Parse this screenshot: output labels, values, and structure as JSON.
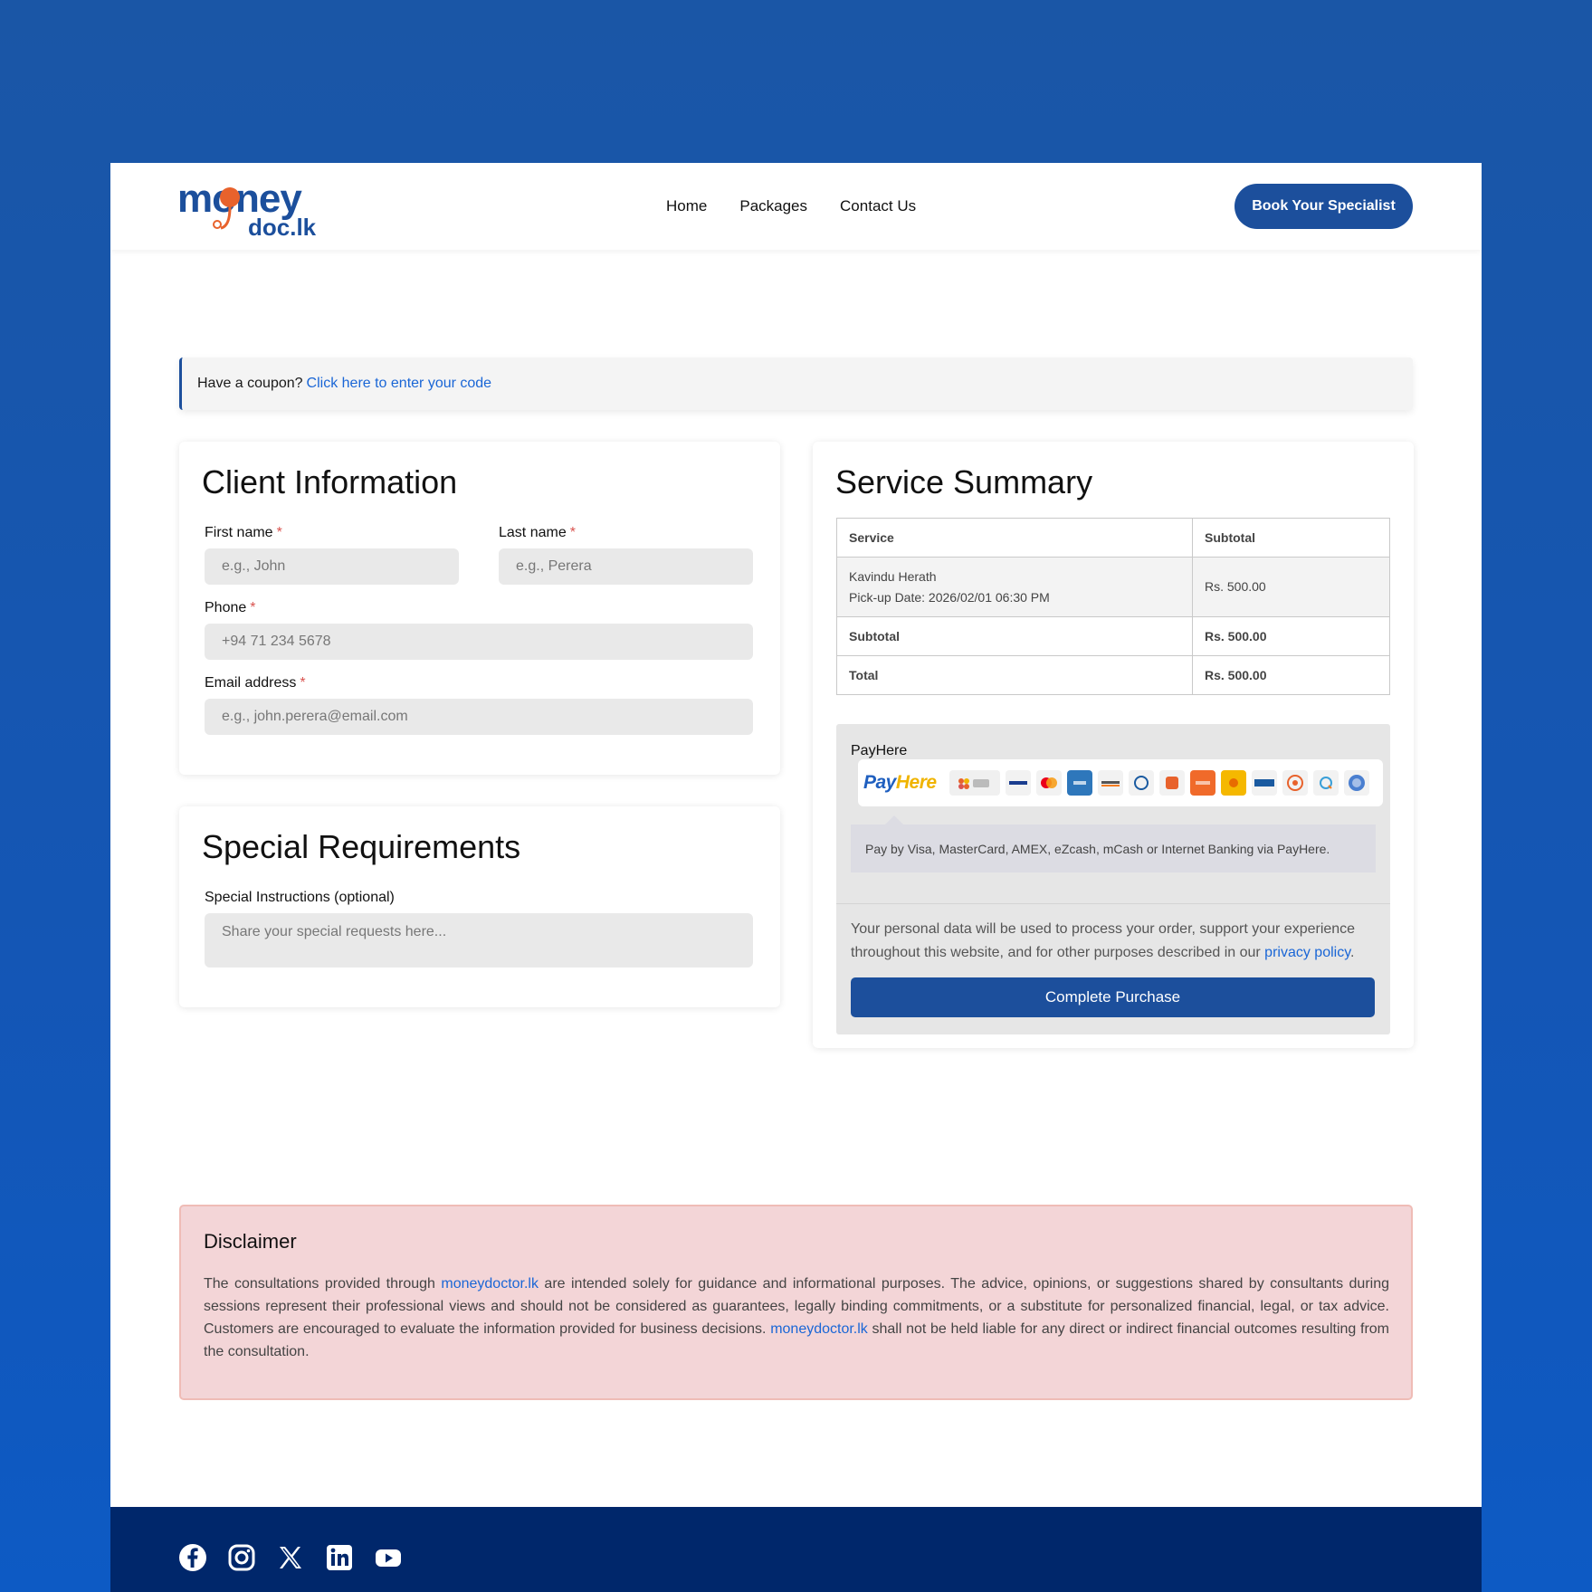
{
  "header": {
    "logo": {
      "word_top": "money",
      "word_bottom": "doc.lk"
    },
    "nav": [
      "Home",
      "Packages",
      "Contact Us"
    ],
    "cta_label": "Book Your Specialist"
  },
  "coupon": {
    "prefix": "Have a coupon?",
    "link": "Click here to enter your code"
  },
  "client": {
    "title": "Client Information",
    "first_name": {
      "label": "First name",
      "placeholder": "e.g., John"
    },
    "last_name": {
      "label": "Last name",
      "placeholder": "e.g., Perera"
    },
    "phone": {
      "label": "Phone",
      "placeholder": "+94 71 234 5678"
    },
    "email": {
      "label": "Email address",
      "placeholder": "e.g., john.perera@email.com"
    },
    "required_mark": "*"
  },
  "special": {
    "title": "Special Requirements",
    "label": "Special Instructions (optional)",
    "placeholder": "Share your special requests here..."
  },
  "summary": {
    "title": "Service Summary",
    "headers": {
      "service": "Service",
      "subtotal": "Subtotal"
    },
    "item": {
      "name": "Kavindu Herath",
      "detail": "Pick-up Date: 2026/02/01 06:30 PM",
      "price": "Rs. 500.00"
    },
    "subtotal": {
      "label": "Subtotal",
      "value": "Rs. 500.00"
    },
    "total": {
      "label": "Total",
      "value": "Rs. 500.00"
    }
  },
  "payment": {
    "method": "PayHere",
    "logo_part1": "Pay",
    "logo_part2": "Here",
    "description": "Pay by Visa, MasterCard, AMEX, eZcash, mCash or Internet Banking via PayHere.",
    "privacy_text": "Your personal data will be used to process your order, support your experience throughout this website, and for other purposes described in our ",
    "privacy_link": "privacy policy",
    "privacy_end": ".",
    "button": "Complete Purchase",
    "icons": [
      "apple-pay-icon",
      "visa-icon",
      "mastercard-icon",
      "amex-icon",
      "discover-icon",
      "diners-icon",
      "genie-icon",
      "frimi-icon",
      "ezcash-icon",
      "bank-icon",
      "seal-icon",
      "q-icon",
      "globe-icon"
    ]
  },
  "disclaimer": {
    "title": "Disclaimer",
    "t1": "The consultations provided through ",
    "link1": "moneydoctor.lk",
    "t2": " are intended solely for guidance and informational purposes. The advice, opinions, or suggestions shared by consultants during sessions represent their professional views and should not be considered as guarantees, legally binding commitments, or a substitute for personalized financial, legal, or tax advice. Customers are encouraged to evaluate the information provided for business decisions. ",
    "link2": "moneydoctor.lk",
    "t3": " shall not be held liable for any direct or indirect financial outcomes resulting from the consultation."
  },
  "footer": {
    "socials": [
      "facebook-icon",
      "instagram-icon",
      "x-icon",
      "linkedin-icon",
      "youtube-icon"
    ]
  },
  "colors": {
    "brand": "#1c4f9c",
    "link": "#1a66d6",
    "footer": "#00276b",
    "accent_orange": "#e8622c"
  }
}
